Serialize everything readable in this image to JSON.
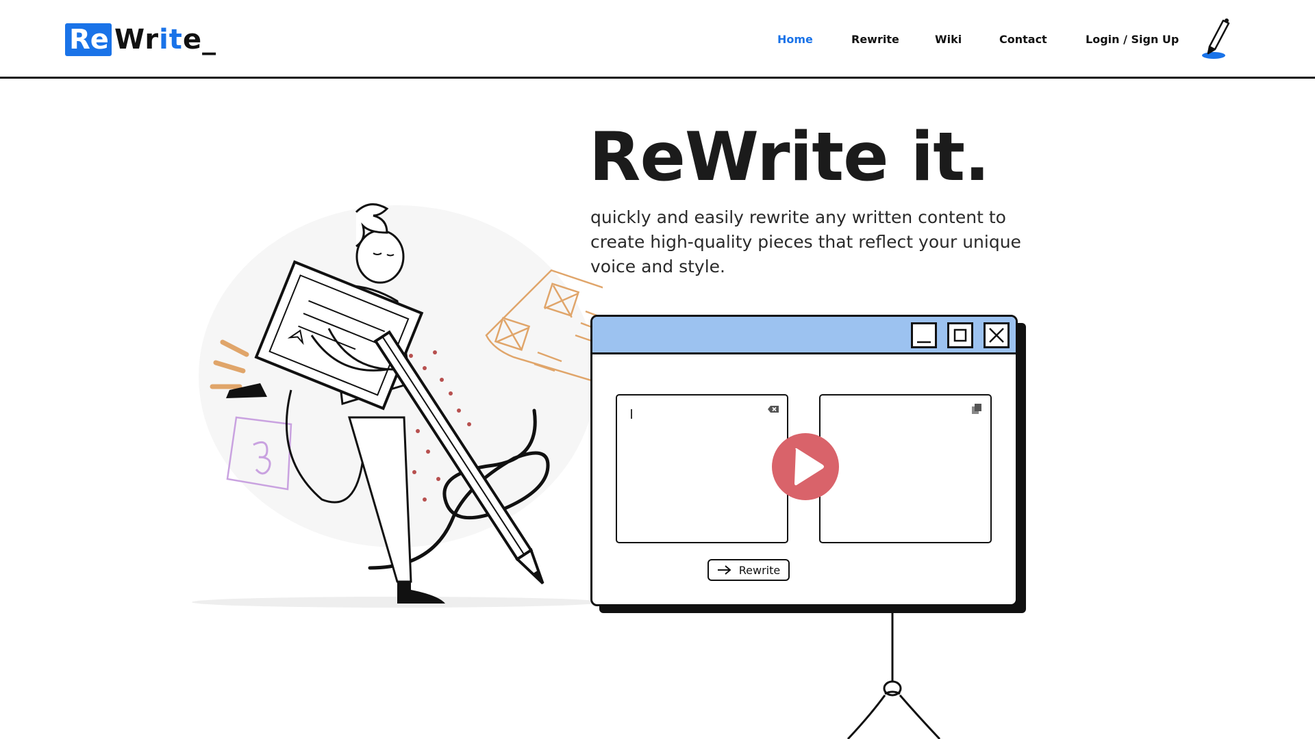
{
  "brand": {
    "logo_prefix": "Re",
    "logo_part1": "Wr",
    "logo_part2": "it",
    "logo_part3": "e_",
    "accent": "#1a73e8"
  },
  "nav": {
    "items": [
      {
        "label": "Home",
        "active": true
      },
      {
        "label": "Rewrite",
        "active": false
      },
      {
        "label": "Wiki",
        "active": false
      },
      {
        "label": "Contact",
        "active": false
      },
      {
        "label": "Login / Sign Up",
        "active": false
      }
    ],
    "pen_icon": "pen-icon"
  },
  "hero": {
    "title": "ReWrite it.",
    "subtitle": "quickly and easily rewrite any written content to create high-quality pieces that reflect your unique voice and style."
  },
  "app_window": {
    "titlebar_color": "#9cc2f0",
    "controls": [
      "minimize-icon",
      "maximize-icon",
      "close-icon"
    ],
    "input": {
      "value": "",
      "placeholder": ""
    },
    "output": {
      "value": ""
    },
    "play_color": "#d9636a",
    "rewrite_label": "Rewrite"
  }
}
